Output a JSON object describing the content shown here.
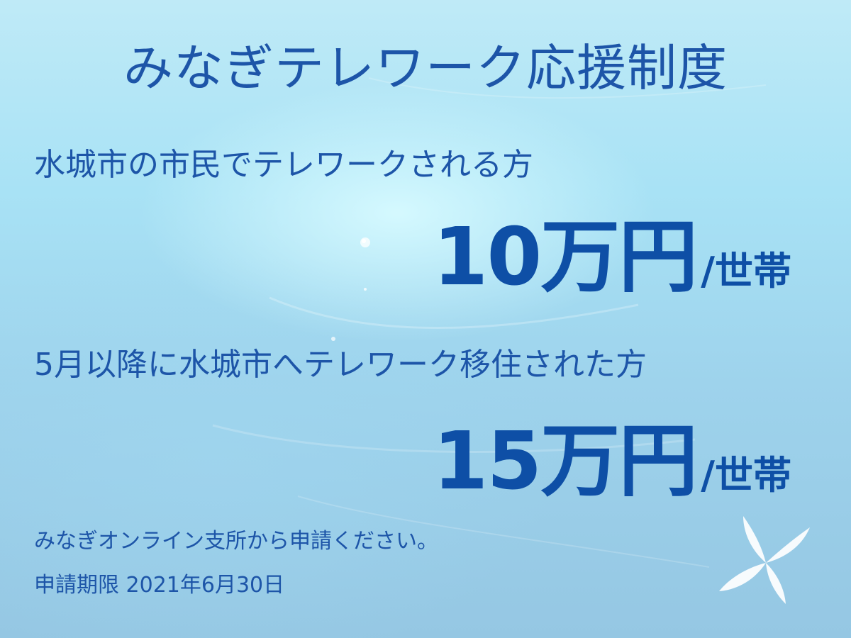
{
  "title": "みなぎテレワーク応援制度",
  "section1": {
    "description": "水城市の市民でテレワークされる方",
    "amount": "10万円",
    "unit": "/世帯"
  },
  "section2": {
    "description": "5月以降に水城市へテレワーク移住された方",
    "amount": "15万円",
    "unit": "/世帯"
  },
  "footer": {
    "apply_text": "みなぎオンライン支所から申請ください。",
    "deadline_text": "申請期限 2021年6月30日"
  },
  "colors": {
    "text": "#1d55a8",
    "amount": "#0e4fa6"
  },
  "icons": [
    "flower-logo-icon"
  ]
}
